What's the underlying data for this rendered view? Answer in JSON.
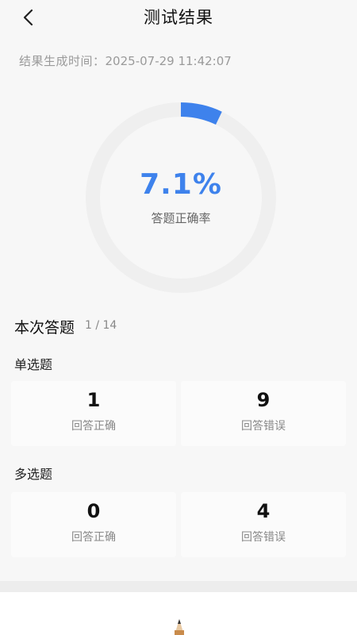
{
  "header": {
    "title": "测试结果",
    "back_icon": "chevron-left-icon"
  },
  "generation": {
    "label": "结果生成时间：",
    "time": "2025-07-29 11:42:07"
  },
  "score": {
    "percent_text": "7.1%",
    "fraction": 0.071,
    "label": "答题正确率",
    "accent_color": "#3e82ec",
    "track_color": "#efefef"
  },
  "summary": {
    "title": "本次答题",
    "count": "1 / 14"
  },
  "single_choice": {
    "title": "单选题",
    "correct_value": "1",
    "correct_label": "回答正确",
    "wrong_value": "9",
    "wrong_label": "回答错误"
  },
  "multiple_choice": {
    "title": "多选题",
    "correct_value": "0",
    "correct_label": "回答正确",
    "wrong_value": "4",
    "wrong_label": "回答错误"
  },
  "footer": {
    "deco_icon": "pencil-icon"
  }
}
